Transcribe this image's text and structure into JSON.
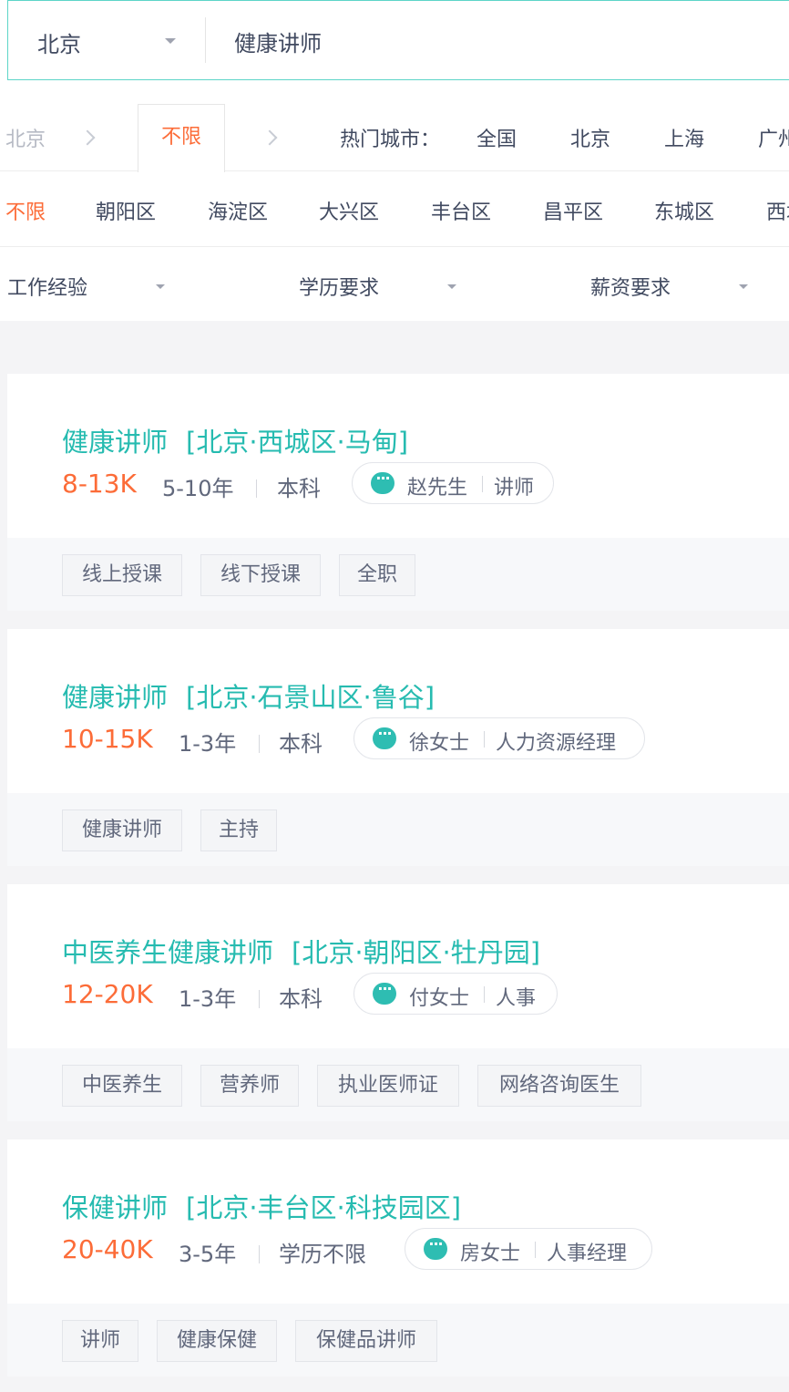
{
  "search": {
    "city": "北京",
    "query": "健康讲师"
  },
  "location_bar": {
    "breadcrumb_city": "北京",
    "selected_area": "不限",
    "hot_label": "热门城市：",
    "hot_cities": [
      "全国",
      "北京",
      "上海",
      "广州"
    ]
  },
  "districts": [
    "不限",
    "朝阳区",
    "海淀区",
    "大兴区",
    "丰台区",
    "昌平区",
    "东城区",
    "西城区"
  ],
  "filters": [
    "工作经验",
    "学历要求",
    "薪资要求"
  ],
  "jobs": [
    {
      "title": "健康讲师",
      "location": "[北京·西城区·马甸]",
      "salary": "8-13K",
      "experience": "5-10年",
      "education": "本科",
      "recruiter": "赵先生",
      "recruiter_role": "讲师",
      "tags": [
        "线上授课",
        "线下授课",
        "全职"
      ]
    },
    {
      "title": "健康讲师",
      "location": "[北京·石景山区·鲁谷]",
      "salary": "10-15K",
      "experience": "1-3年",
      "education": "本科",
      "recruiter": "徐女士",
      "recruiter_role": "人力资源经理",
      "tags": [
        "健康讲师",
        "主持"
      ]
    },
    {
      "title": "中医养生健康讲师",
      "location": "[北京·朝阳区·牡丹园]",
      "salary": "12-20K",
      "experience": "1-3年",
      "education": "本科",
      "recruiter": "付女士",
      "recruiter_role": "人事",
      "tags": [
        "中医养生",
        "营养师",
        "执业医师证",
        "网络咨询医生"
      ]
    },
    {
      "title": "保健讲师",
      "location": "[北京·丰台区·科技园区]",
      "salary": "20-40K",
      "experience": "3-5年",
      "education": "学历不限",
      "recruiter": "房女士",
      "recruiter_role": "人事经理",
      "tags": [
        "讲师",
        "健康保健",
        "保健品讲师"
      ]
    }
  ],
  "colors": {
    "accent": "#26bbb0",
    "salary": "#fc6c38",
    "search_border": "#5dd5c8",
    "text": "#414a60"
  }
}
